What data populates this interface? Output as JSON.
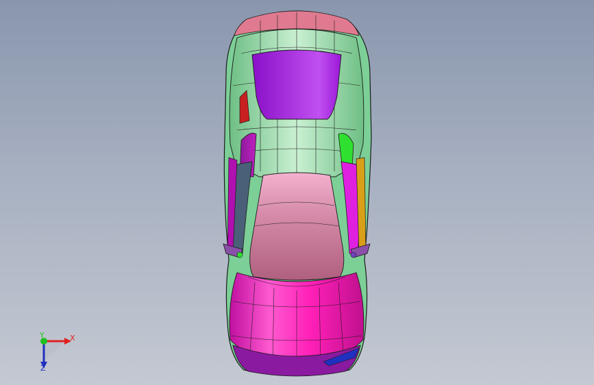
{
  "triad": {
    "x_label": "X",
    "y_label": "Y",
    "z_label": "Z",
    "colors": {
      "x": "#e02020",
      "y": "#20c020",
      "z": "#2030c0"
    }
  },
  "model": {
    "colors": {
      "roof": "#9ad8a8",
      "sunroof": "#a020d8",
      "rear_window": "#c06a8c",
      "hood": "#ff20b8",
      "side_glass_left": "#4a6078",
      "side_glass_right": "#e020e0",
      "door_left": "#b010b0",
      "door_right": "#30e030",
      "mirror_accent": "#c82020",
      "front_bumper": "#8a1aa0",
      "body_outline": "#1a1a1a"
    }
  }
}
